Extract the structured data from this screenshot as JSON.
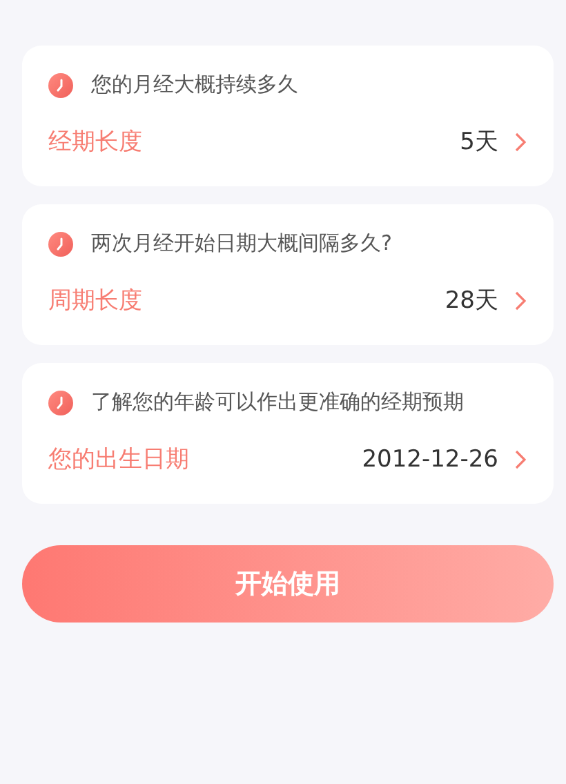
{
  "cards": [
    {
      "question": "您的月经大概持续多久",
      "label": "经期长度",
      "value": "5天"
    },
    {
      "question": "两次月经开始日期大概间隔多久?",
      "label": "周期长度",
      "value": "28天"
    },
    {
      "question": "了解您的年龄可以作出更准确的经期预期",
      "label": "您的出生日期",
      "value": "2012-12-26"
    }
  ],
  "start_button": "开始使用"
}
